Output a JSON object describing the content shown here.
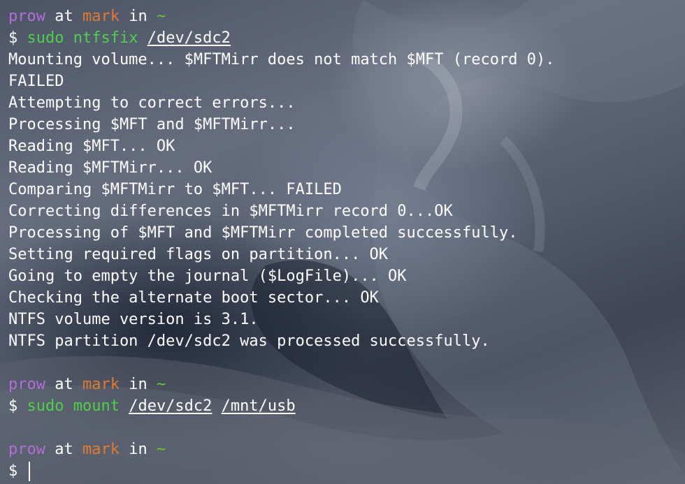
{
  "prompt": {
    "user": "prow",
    "at": "at",
    "host": "mark",
    "in": "in",
    "dir": "~",
    "symbol": "$"
  },
  "command1": {
    "cmd": "sudo ntfsfix",
    "arg1": "/dev/sdc2"
  },
  "output": [
    "Mounting volume... $MFTMirr does not match $MFT (record 0).",
    "FAILED",
    "Attempting to correct errors...",
    "Processing $MFT and $MFTMirr...",
    "Reading $MFT... OK",
    "Reading $MFTMirr... OK",
    "Comparing $MFTMirr to $MFT... FAILED",
    "Correcting differences in $MFTMirr record 0...OK",
    "Processing of $MFT and $MFTMirr completed successfully.",
    "Setting required flags on partition... OK",
    "Going to empty the journal ($LogFile)... OK",
    "Checking the alternate boot sector... OK",
    "NTFS volume version is 3.1.",
    "NTFS partition /dev/sdc2 was processed successfully."
  ],
  "command2": {
    "cmd": "sudo mount",
    "arg1": "/dev/sdc2",
    "arg2": "/mnt/usb"
  }
}
